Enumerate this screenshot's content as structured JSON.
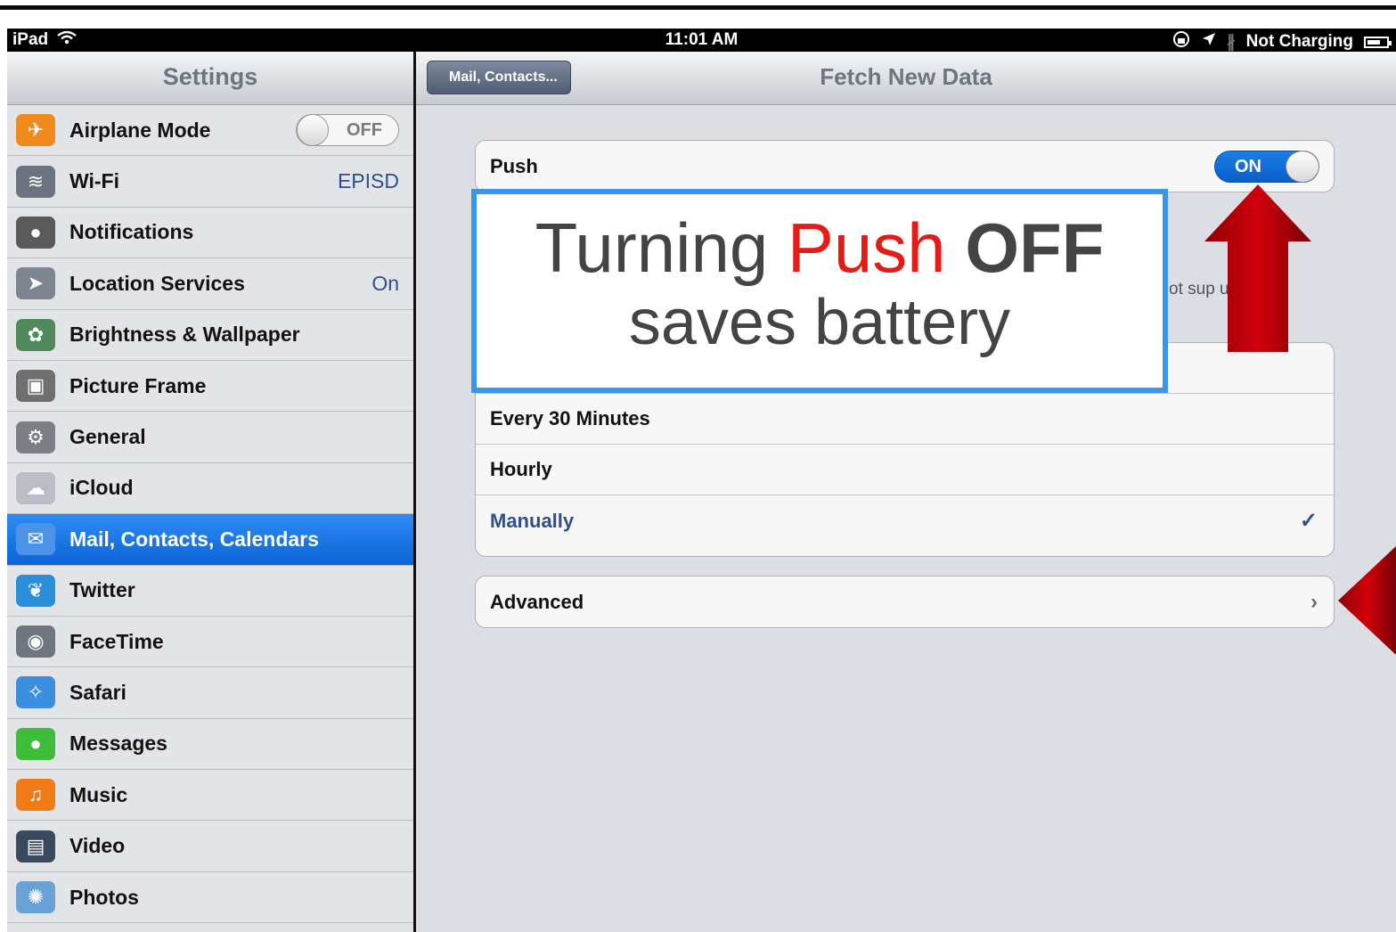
{
  "status_bar": {
    "device": "iPad",
    "time": "11:01 AM",
    "charging": "Not Charging"
  },
  "master": {
    "title": "Settings",
    "items": [
      {
        "label": "Airplane Mode",
        "value": "OFF",
        "icon": "airplane-icon",
        "color": "#f08a1c"
      },
      {
        "label": "Wi-Fi",
        "value": "EPISD",
        "icon": "wifi-icon",
        "color": "#6a7380"
      },
      {
        "label": "Notifications",
        "value": "",
        "icon": "notifications-icon",
        "color": "#5a5a5a"
      },
      {
        "label": "Location Services",
        "value": "On",
        "icon": "location-icon",
        "color": "#7d8590"
      },
      {
        "label": "Brightness & Wallpaper",
        "value": "",
        "icon": "flower-icon",
        "color": "#4f8a5b"
      },
      {
        "label": "Picture Frame",
        "value": "",
        "icon": "picture-frame-icon",
        "color": "#6f6f6f"
      },
      {
        "label": "General",
        "value": "",
        "icon": "gear-icon",
        "color": "#7a7f86"
      },
      {
        "label": "iCloud",
        "value": "",
        "icon": "cloud-icon",
        "color": "#b9bec6"
      },
      {
        "label": "Mail, Contacts, Calendars",
        "value": "",
        "icon": "mail-icon",
        "color": "#4a93e8"
      },
      {
        "label": "Twitter",
        "value": "",
        "icon": "twitter-bird-icon",
        "color": "#2a8fd8"
      },
      {
        "label": "FaceTime",
        "value": "",
        "icon": "camera-icon",
        "color": "#6f7680"
      },
      {
        "label": "Safari",
        "value": "",
        "icon": "compass-icon",
        "color": "#3c8fe0"
      },
      {
        "label": "Messages",
        "value": "",
        "icon": "message-bubble-icon",
        "color": "#3dbd3a"
      },
      {
        "label": "Music",
        "value": "",
        "icon": "music-note-icon",
        "color": "#f07a16"
      },
      {
        "label": "Video",
        "value": "",
        "icon": "clapper-icon",
        "color": "#3a4a5e"
      },
      {
        "label": "Photos",
        "value": "",
        "icon": "sunflower-icon",
        "color": "#6aa2d8"
      }
    ]
  },
  "detail": {
    "back_label": "Mail, Contacts...",
    "title": "Fetch New Data",
    "push_label": "Push",
    "push_state": "ON",
    "footnote": "ot sup        ush.",
    "schedule": [
      {
        "label": "Every 30 Minutes",
        "checked": false
      },
      {
        "label": "Hourly",
        "checked": false
      },
      {
        "label": "Manually",
        "checked": true
      }
    ],
    "check_mark": "✓",
    "advanced_label": "Advanced",
    "chevron": "›"
  },
  "callout": {
    "line1_a": "Turning ",
    "line1_b": "Push",
    "line1_c": " OFF",
    "line2": "saves battery"
  },
  "colors": {
    "accent_blue": "#1c7ee8",
    "arrow_red": "#c4000a",
    "callout_border": "#3d95e8",
    "selected_row": "#0b63d6"
  }
}
